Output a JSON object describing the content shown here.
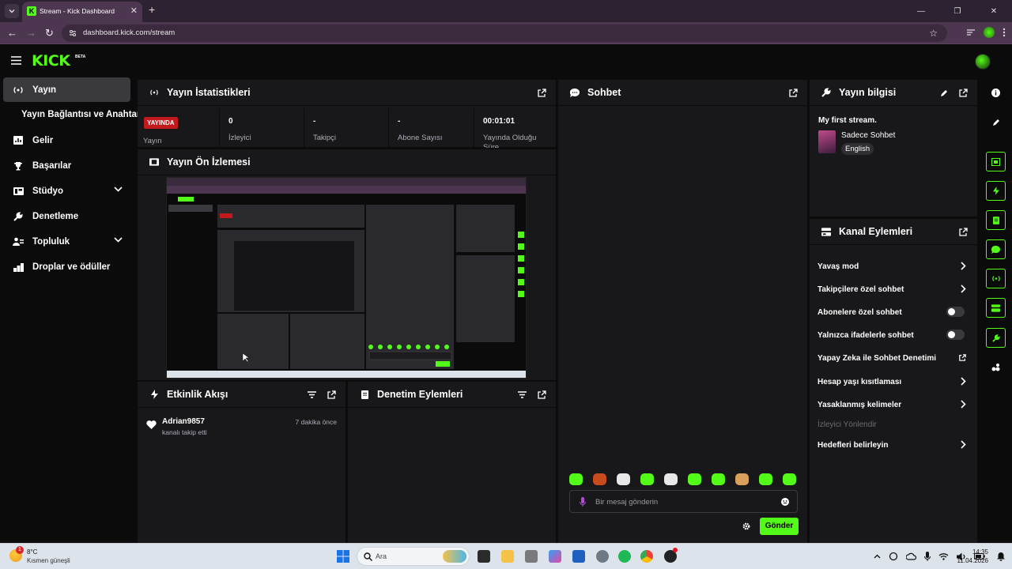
{
  "browser": {
    "tab_title": "Stream - Kick Dashboard",
    "url": "dashboard.kick.com/stream"
  },
  "app": {
    "logo": "KICK",
    "logo_badge": "BETA"
  },
  "sidebar": {
    "items": [
      {
        "label": "Yayın",
        "icon": "broadcast-icon"
      },
      {
        "label": "Yayın Bağlantısı ve Anahtarı"
      },
      {
        "label": "Gelir",
        "icon": "chart-icon"
      },
      {
        "label": "Başarılar",
        "icon": "trophy-icon"
      },
      {
        "label": "Stüdyo",
        "icon": "studio-icon"
      },
      {
        "label": "Denetleme",
        "icon": "wrench-icon"
      },
      {
        "label": "Topluluk",
        "icon": "community-icon"
      },
      {
        "label": "Droplar ve ödüller",
        "icon": "drops-icon"
      }
    ]
  },
  "stats": {
    "title": "Yayın İstatistikleri",
    "live_badge": "YAYINDA",
    "cells": [
      {
        "value": "",
        "label": "Yayın"
      },
      {
        "value": "0",
        "label": "İzleyici"
      },
      {
        "value": "-",
        "label": "Takipçi"
      },
      {
        "value": "-",
        "label": "Abone Sayısı"
      },
      {
        "value": "00:01:01",
        "label": "Yayında Olduğu Süre"
      }
    ]
  },
  "preview": {
    "title": "Yayın Ön İzlemesi"
  },
  "activity": {
    "title": "Etkinlik Akışı",
    "events": [
      {
        "user": "Adrian9857",
        "action": "kanalı takip etti",
        "time": "7 dakika önce"
      }
    ]
  },
  "mod_actions": {
    "title": "Denetim Eylemleri"
  },
  "chat": {
    "title": "Sohbet",
    "placeholder": "Bir mesaj gönderin",
    "send_label": "Gönder"
  },
  "stream_info": {
    "title": "Yayın bilgisi",
    "stream_title": "My first stream.",
    "category": "Sadece Sohbet",
    "language": "English"
  },
  "channel_actions": {
    "title": "Kanal Eylemleri",
    "rows": [
      {
        "label": "Yavaş mod",
        "control": "chevron"
      },
      {
        "label": "Takipçilere özel sohbet",
        "control": "chevron"
      },
      {
        "label": "Abonelere özel sohbet",
        "control": "toggle",
        "on": false
      },
      {
        "label": "Yalnızca ifadelerle sohbet",
        "control": "toggle",
        "on": false
      },
      {
        "label": "Yapay Zeka ile Sohbet Denetimi",
        "control": "external"
      },
      {
        "label": "Hesap yaşı kısıtlaması",
        "control": "chevron"
      },
      {
        "label": "Yasaklanmış kelimeler",
        "control": "chevron"
      },
      {
        "label": "İzleyici Yönlendir",
        "control": "none",
        "disabled": true
      },
      {
        "label": "Hedefleri belirleyin",
        "control": "chevron"
      }
    ]
  },
  "taskbar": {
    "weather_temp": "8°C",
    "weather_desc": "Kısmen güneşli",
    "search": "Ara",
    "time": "14:35",
    "date": "11.04.2026",
    "notification_count": "1"
  },
  "colors": {
    "accent": "#53fc18",
    "panel": "#18181b",
    "background": "#0b0b0c",
    "live": "#c2191d"
  }
}
